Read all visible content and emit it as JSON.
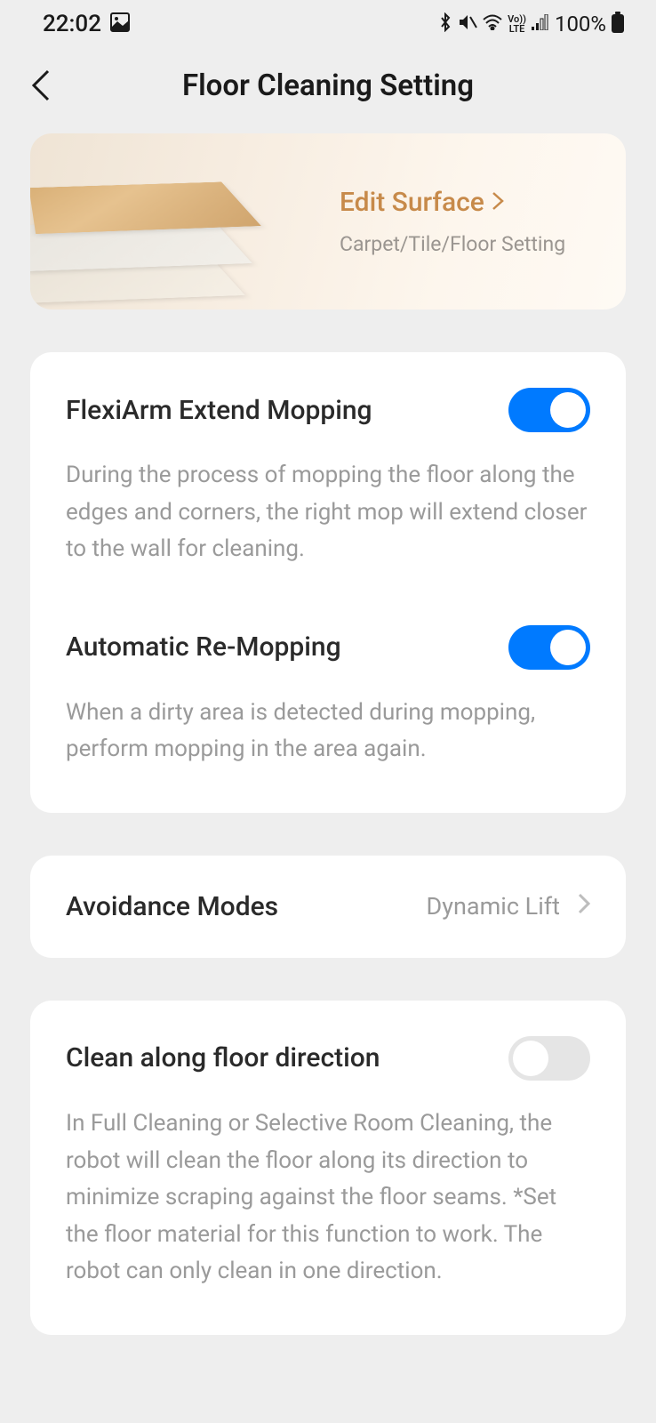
{
  "status_bar": {
    "time": "22:02",
    "battery": "100%"
  },
  "header": {
    "title": "Floor Cleaning Setting"
  },
  "surface_card": {
    "title": "Edit Surface",
    "subtitle": "Carpet/Tile/Floor Setting"
  },
  "settings": {
    "flexiarm": {
      "title": "FlexiArm Extend Mopping",
      "description": "During the process of mopping the floor along the edges and corners, the right mop will extend closer to the wall for cleaning.",
      "enabled": true
    },
    "remopping": {
      "title": "Automatic Re-Mopping",
      "description": "When a dirty area is detected during mopping, perform mopping in the area again.",
      "enabled": true
    },
    "avoidance": {
      "title": "Avoidance Modes",
      "value": "Dynamic Lift"
    },
    "clean_direction": {
      "title": "Clean along floor direction",
      "description": "In Full Cleaning or Selective Room Cleaning, the robot will clean the floor along its direction to minimize scraping against the floor seams. *Set the floor material for this function to work. The robot can only clean in one direction.",
      "enabled": false
    }
  }
}
